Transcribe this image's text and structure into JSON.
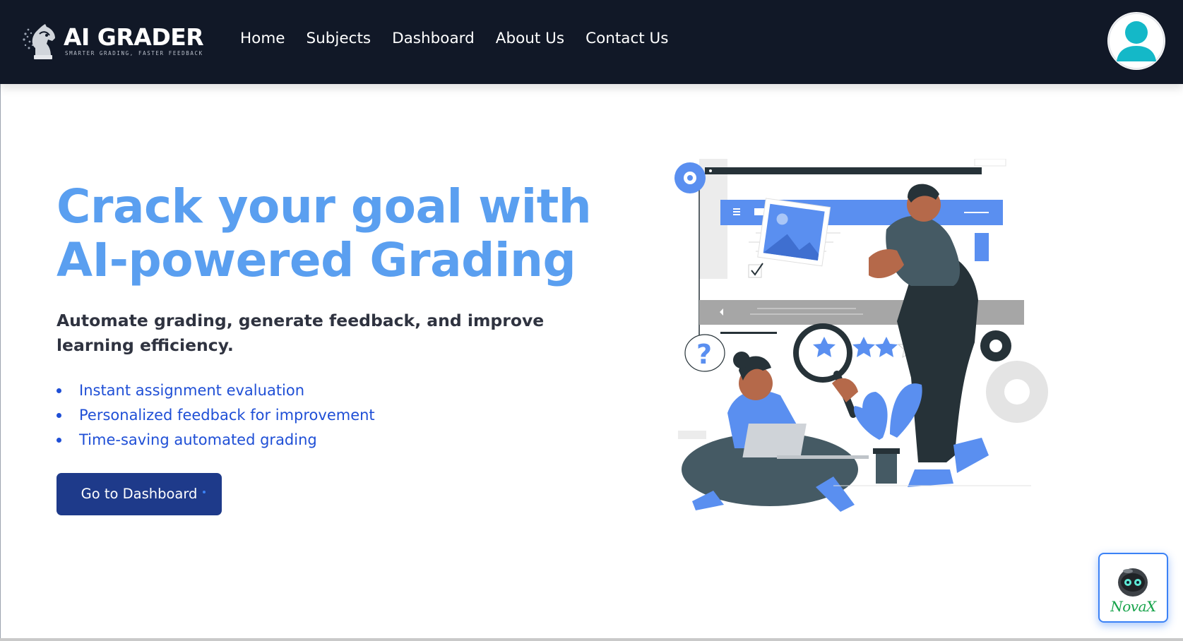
{
  "header": {
    "logo_title": "AI GRADER",
    "logo_tagline": "SMARTER GRADING, FASTER FEEDBACK",
    "nav": [
      {
        "label": "Home"
      },
      {
        "label": "Subjects"
      },
      {
        "label": "Dashboard"
      },
      {
        "label": "About Us"
      },
      {
        "label": "Contact Us"
      }
    ],
    "avatar_icon": "user-icon"
  },
  "hero": {
    "title_line1": "Crack your goal with",
    "title_line2": "AI-powered Grading",
    "subtitle": "Automate grading, generate feedback, and improve learning efficiency.",
    "features": [
      {
        "text": "Instant assignment evaluation"
      },
      {
        "text": "Personalized feedback for improvement"
      },
      {
        "text": "Time-saving automated grading"
      }
    ],
    "cta_label": "Go to Dashboard"
  },
  "chat_widget": {
    "label": "NovaX",
    "icon": "robot-icon"
  },
  "colors": {
    "header_bg": "#111827",
    "accent": "#5a9ff0",
    "cta_bg": "#1e3a8a",
    "feature_text": "#1f4fd6"
  }
}
